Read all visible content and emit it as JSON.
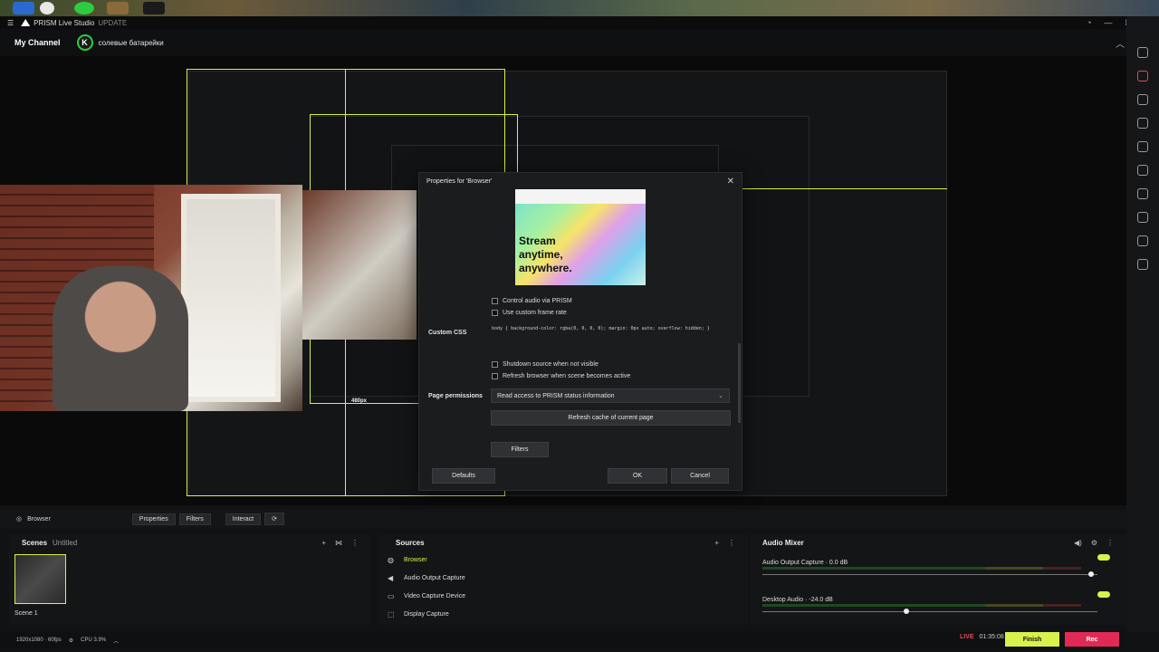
{
  "app": {
    "title": "PRISM Live Studio",
    "update_label": "UPDATE"
  },
  "channel": {
    "my_channel": "My Channel",
    "avatar_letter": "K",
    "name": "солевые батарейки"
  },
  "dialog": {
    "title": "Properties for 'Browser'",
    "ad_lines": [
      "Stream",
      "anytime,",
      "anywhere."
    ],
    "control_audio": "Control audio via PRISM",
    "custom_frame_rate": "Use custom frame rate",
    "custom_css_label": "Custom CSS",
    "custom_css_value": "body { background-color: rgba(0, 0, 0, 0); margin: 0px auto; overflow: hidden; }",
    "shutdown_source": "Shutdown source when not visible",
    "refresh_browser": "Refresh browser when scene becomes active",
    "page_permissions_label": "Page permissions",
    "page_permissions_value": "Read access to PRISM status information",
    "refresh_cache": "Refresh cache of current page",
    "filters": "Filters",
    "defaults": "Defaults",
    "ok": "OK",
    "cancel": "Cancel"
  },
  "preview": {
    "resolution_label": "480px"
  },
  "toolbar": {
    "source_name": "Browser",
    "properties": "Properties",
    "filters": "Filters",
    "interact": "Interact"
  },
  "scenes": {
    "title": "Scenes",
    "collection": "Untitled",
    "items": [
      {
        "label": "Scene 1"
      }
    ]
  },
  "sources": {
    "title": "Sources",
    "items": [
      {
        "label": "Browser",
        "icon": "globe-icon",
        "active": true
      },
      {
        "label": "Audio Output Capture",
        "icon": "speaker-icon",
        "active": false
      },
      {
        "label": "Video Capture Device",
        "icon": "camera-icon",
        "active": false
      },
      {
        "label": "Display Capture",
        "icon": "monitor-icon",
        "active": false
      }
    ]
  },
  "mixer": {
    "title": "Audio Mixer",
    "channels": [
      {
        "label": "Audio Output Capture · 0.0 dB",
        "level": 0.98
      },
      {
        "label": "Desktop Audio · -24.0 dB",
        "level": 0.43
      }
    ]
  },
  "status": {
    "resolution": "1920x1080 · 60fps",
    "cpu": "CPU 3.9%",
    "live_badge": "LIVE",
    "elapsed": "01:35:08",
    "finish": "Finish",
    "rec": "Rec"
  },
  "colors": {
    "accent": "#d9f24b",
    "rec": "#e02a55",
    "live": "#e24b5a",
    "panel": "#141516"
  }
}
